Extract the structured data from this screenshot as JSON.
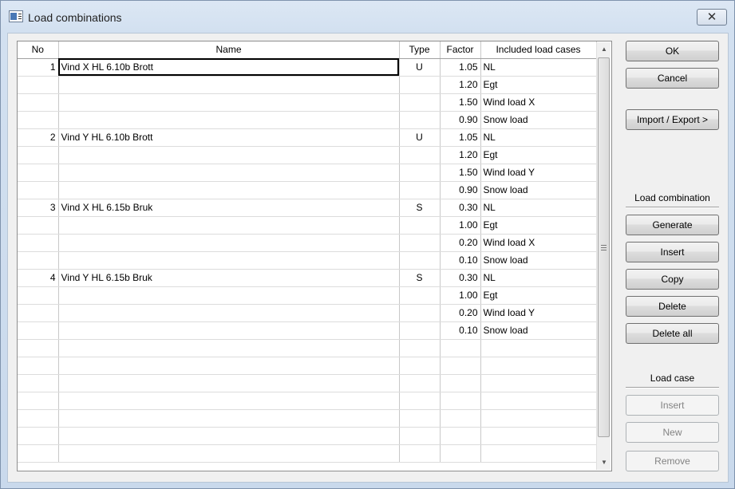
{
  "window": {
    "title": "Load combinations",
    "close_symbol": "✕"
  },
  "grid": {
    "headers": {
      "no": "No",
      "name": "Name",
      "type": "Type",
      "factor": "Factor",
      "cases": "Included load cases"
    },
    "rows": [
      {
        "no": "1",
        "name": "Vind X HL 6.10b Brott",
        "type": "U",
        "factor": "1.05",
        "case": "NL"
      },
      {
        "no": "",
        "name": "",
        "type": "",
        "factor": "1.20",
        "case": "Egt"
      },
      {
        "no": "",
        "name": "",
        "type": "",
        "factor": "1.50",
        "case": "Wind load X"
      },
      {
        "no": "",
        "name": "",
        "type": "",
        "factor": "0.90",
        "case": "Snow load"
      },
      {
        "no": "2",
        "name": "Vind Y HL 6.10b Brott",
        "type": "U",
        "factor": "1.05",
        "case": "NL"
      },
      {
        "no": "",
        "name": "",
        "type": "",
        "factor": "1.20",
        "case": "Egt"
      },
      {
        "no": "",
        "name": "",
        "type": "",
        "factor": "1.50",
        "case": "Wind load Y"
      },
      {
        "no": "",
        "name": "",
        "type": "",
        "factor": "0.90",
        "case": "Snow load"
      },
      {
        "no": "3",
        "name": "Vind X HL 6.15b Bruk",
        "type": "S",
        "factor": "0.30",
        "case": "NL"
      },
      {
        "no": "",
        "name": "",
        "type": "",
        "factor": "1.00",
        "case": "Egt"
      },
      {
        "no": "",
        "name": "",
        "type": "",
        "factor": "0.20",
        "case": "Wind load X"
      },
      {
        "no": "",
        "name": "",
        "type": "",
        "factor": "0.10",
        "case": "Snow load"
      },
      {
        "no": "4",
        "name": "Vind Y HL 6.15b Bruk",
        "type": "S",
        "factor": "0.30",
        "case": "NL"
      },
      {
        "no": "",
        "name": "",
        "type": "",
        "factor": "1.00",
        "case": "Egt"
      },
      {
        "no": "",
        "name": "",
        "type": "",
        "factor": "0.20",
        "case": "Wind load Y"
      },
      {
        "no": "",
        "name": "",
        "type": "",
        "factor": "0.10",
        "case": "Snow load"
      },
      {
        "no": "",
        "name": "",
        "type": "",
        "factor": "",
        "case": ""
      },
      {
        "no": "",
        "name": "",
        "type": "",
        "factor": "",
        "case": ""
      },
      {
        "no": "",
        "name": "",
        "type": "",
        "factor": "",
        "case": ""
      },
      {
        "no": "",
        "name": "",
        "type": "",
        "factor": "",
        "case": ""
      },
      {
        "no": "",
        "name": "",
        "type": "",
        "factor": "",
        "case": ""
      },
      {
        "no": "",
        "name": "",
        "type": "",
        "factor": "",
        "case": ""
      },
      {
        "no": "",
        "name": "",
        "type": "",
        "factor": "",
        "case": ""
      }
    ]
  },
  "buttons": {
    "ok": "OK",
    "cancel": "Cancel",
    "import_export": "Import / Export >",
    "generate": "Generate",
    "insert_combination": "Insert",
    "copy": "Copy",
    "delete": "Delete",
    "delete_all": "Delete all",
    "insert_case": "Insert",
    "new_case": "New",
    "remove_case": "Remove"
  },
  "sections": {
    "load_combination": "Load combination",
    "load_case": "Load case"
  },
  "icons": {
    "scroll_up": "scroll-up-arrow-icon",
    "scroll_down": "scroll-down-arrow-icon"
  }
}
